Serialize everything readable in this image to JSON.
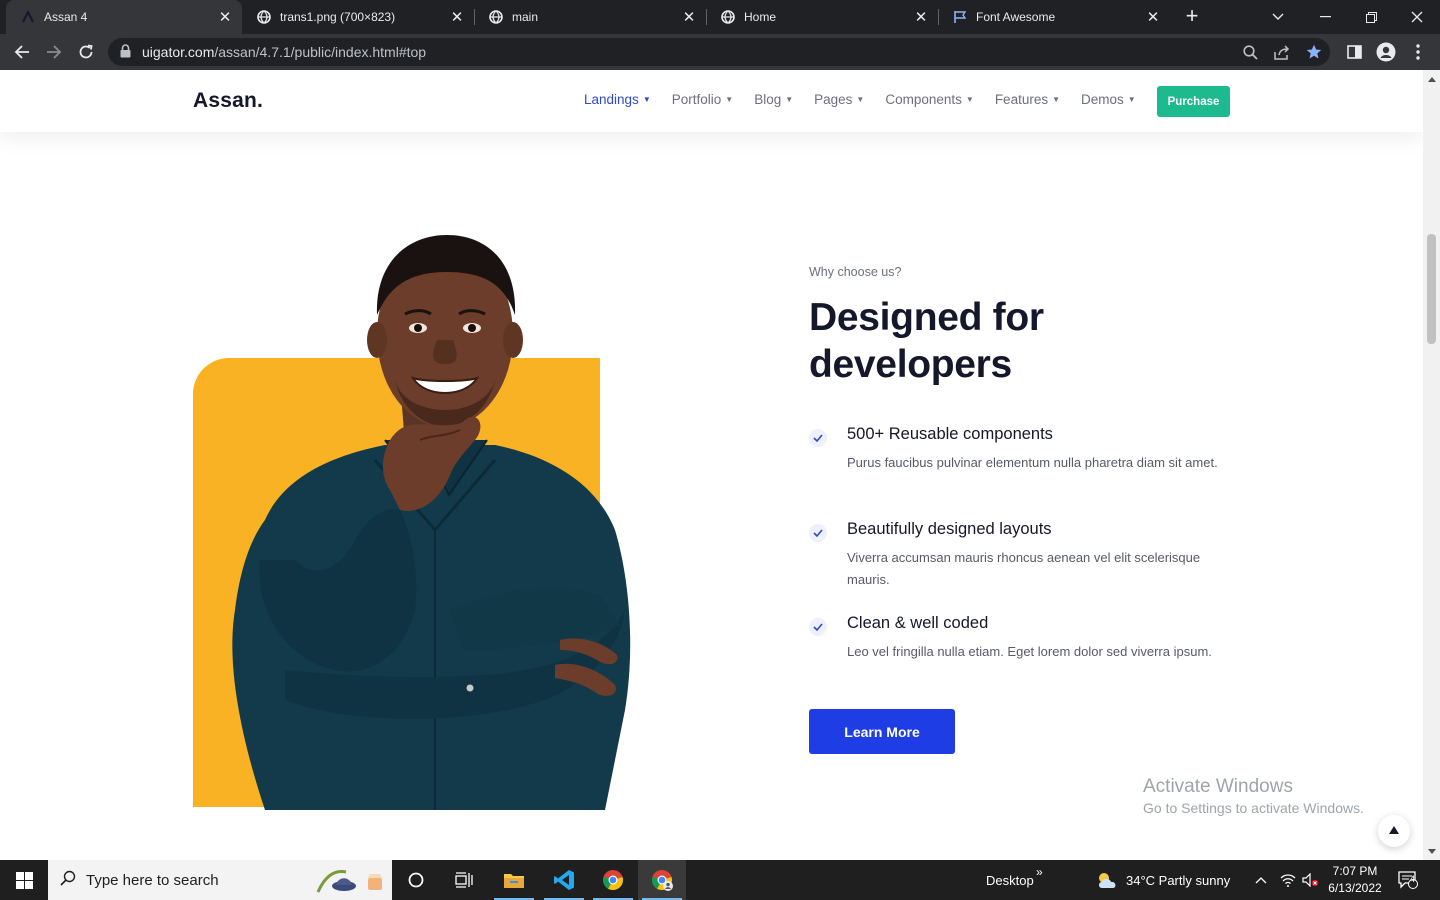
{
  "browser": {
    "tabs": [
      {
        "title": "Assan 4",
        "active": true
      },
      {
        "title": "trans1.png (700×823)",
        "active": false
      },
      {
        "title": "main",
        "active": false
      },
      {
        "title": "Home",
        "active": false
      },
      {
        "title": "Font Awesome",
        "active": false
      }
    ],
    "url_host": "uigator.com",
    "url_path": "/assan/4.7.1/public/index.html#top"
  },
  "site": {
    "brand": "Assan.",
    "nav": [
      {
        "label": "Landings",
        "active": true
      },
      {
        "label": "Portfolio",
        "active": false
      },
      {
        "label": "Blog",
        "active": false
      },
      {
        "label": "Pages",
        "active": false
      },
      {
        "label": "Components",
        "active": false
      },
      {
        "label": "Features",
        "active": false
      },
      {
        "label": "Demos",
        "active": false
      }
    ],
    "purchase": "Purchase"
  },
  "hero": {
    "eyebrow": "Why choose us?",
    "title_line1": "Designed for",
    "title_line2": "developers",
    "features": [
      {
        "title": "500+ Reusable components",
        "desc": "Purus faucibus pulvinar elementum nulla pharetra diam sit amet."
      },
      {
        "title": "Beautifully designed layouts",
        "desc": "Viverra accumsan mauris rhoncus aenean vel elit scelerisque mauris."
      },
      {
        "title": "Clean & well coded",
        "desc": "Leo vel fringilla nulla etiam. Eget lorem dolor sed viverra ipsum."
      }
    ],
    "cta": "Learn More"
  },
  "watermark": {
    "line1": "Activate Windows",
    "line2": "Go to Settings to activate Windows."
  },
  "taskbar": {
    "search_placeholder": "Type here to search",
    "desktop_label": "Desktop",
    "weather": "34°C  Partly sunny",
    "time": "7:07 PM",
    "date": "6/13/2022",
    "notification_count": "4"
  },
  "colors": {
    "accent_blue": "#1e3de4",
    "nav_active": "#2f49d1",
    "purchase_green": "#1cba8e",
    "card_yellow": "#f9b224",
    "heading": "#15172a"
  }
}
